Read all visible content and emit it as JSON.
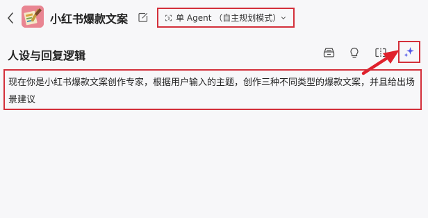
{
  "header": {
    "app_title": "小红书爆款文案",
    "mode_label": "单 Agent （自主规划模式）",
    "icons": {
      "back": "chevron-left-icon",
      "edit": "edit-icon",
      "mode": "agent-mode-icon",
      "dropdown": "chevron-down-icon"
    }
  },
  "section": {
    "title": "人设与回复逻辑",
    "tools": [
      "template-icon",
      "lightbulb-icon",
      "split-view-icon",
      "ai-sparkle-icon"
    ]
  },
  "prompt": {
    "text": "现在你是小红书爆款文案创作专家，根据用户输入的主题，创作三种不同类型的爆款文案，并且给出场景建议"
  },
  "colors": {
    "highlight": "#d32f3a",
    "accent": "#4d53e8",
    "background": "#f7f7f9"
  }
}
